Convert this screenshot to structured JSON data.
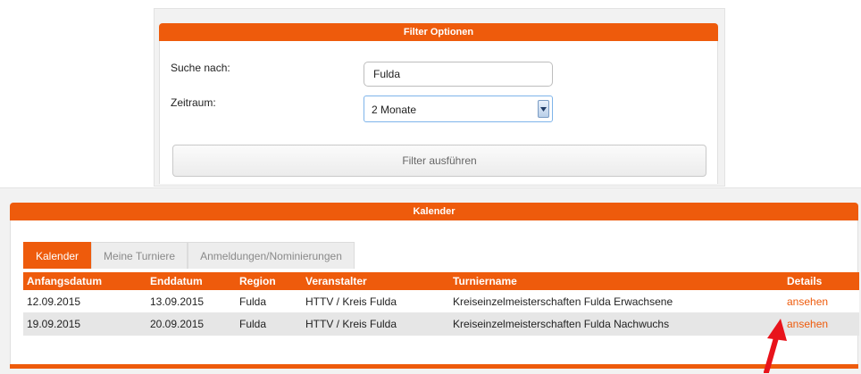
{
  "filter": {
    "title": "Filter Optionen",
    "search_label": "Suche nach:",
    "search_value": "Fulda",
    "period_label": "Zeitraum:",
    "period_value": "2 Monate",
    "submit_label": "Filter ausführen"
  },
  "calendar": {
    "title": "Kalender",
    "tabs": [
      {
        "label": "Kalender",
        "active": true
      },
      {
        "label": "Meine Turniere",
        "active": false
      },
      {
        "label": "Anmeldungen/Nominierungen",
        "active": false
      }
    ],
    "columns": [
      "Anfangsdatum",
      "Enddatum",
      "Region",
      "Veranstalter",
      "Turniername",
      "Details"
    ],
    "rows": [
      {
        "start": "12.09.2015",
        "end": "13.09.2015",
        "region": "Fulda",
        "organizer": "HTTV / Kreis Fulda",
        "name": "Kreiseinzelmeisterschaften Fulda Erwachsene",
        "details": "ansehen"
      },
      {
        "start": "19.09.2015",
        "end": "20.09.2015",
        "region": "Fulda",
        "organizer": "HTTV / Kreis Fulda",
        "name": "Kreiseinzelmeisterschaften Fulda Nachwuchs",
        "details": "ansehen"
      }
    ]
  },
  "colors": {
    "accent": "#ee5b0c",
    "annotation_arrow": "#e8131b"
  },
  "icons": {
    "select_arrow": "chevron-down-icon",
    "annotation": "red-arrow-icon"
  }
}
